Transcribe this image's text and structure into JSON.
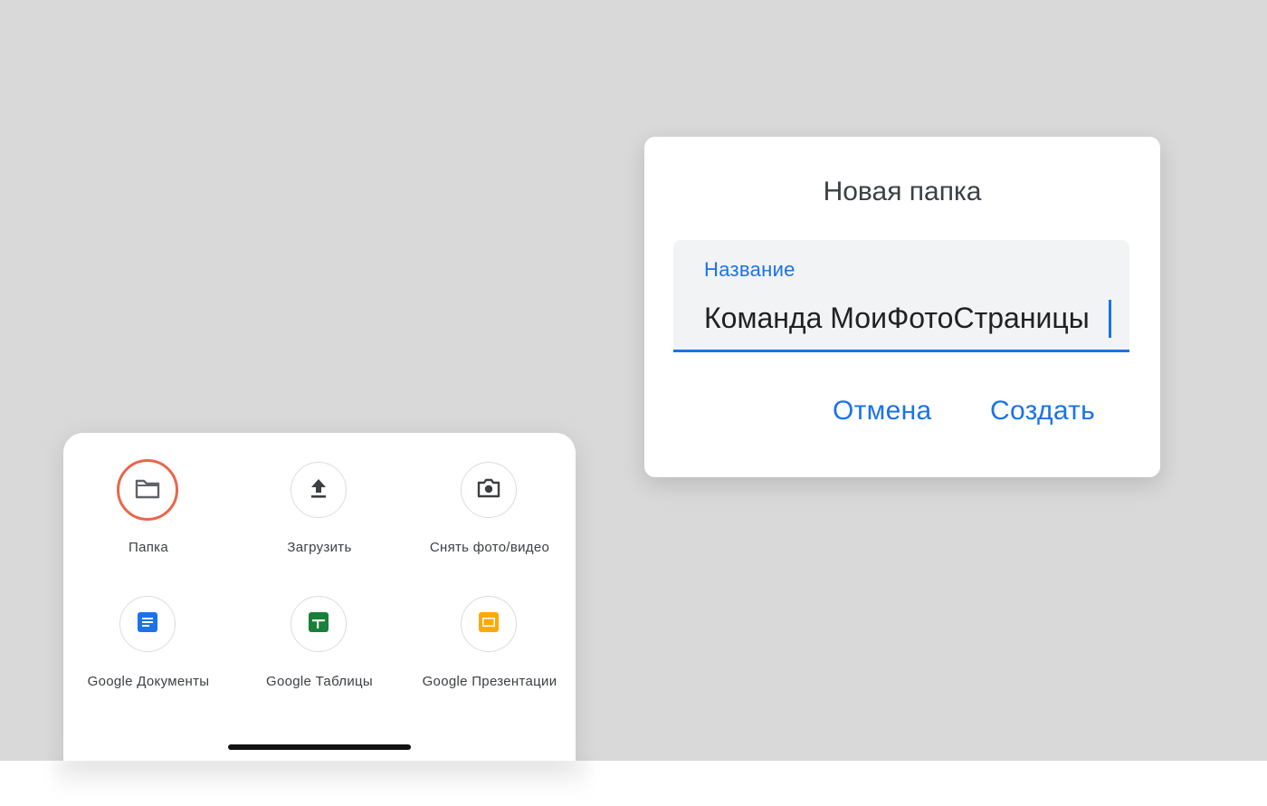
{
  "new_sheet": {
    "items": [
      {
        "label": "Папка",
        "icon": "folder-icon"
      },
      {
        "label": "Загрузить",
        "icon": "upload-icon"
      },
      {
        "label": "Снять фото/видео",
        "icon": "camera-icon"
      },
      {
        "label": "Google Документы",
        "icon": "google-docs-icon"
      },
      {
        "label": "Google Таблицы",
        "icon": "google-sheets-icon"
      },
      {
        "label": "Google Презентации",
        "icon": "google-slides-icon"
      }
    ]
  },
  "dialog": {
    "title": "Новая папка",
    "field_label": "Название",
    "field_value": "Команда МоиФотоСтраницы",
    "cancel_label": "Отмена",
    "create_label": "Создать"
  },
  "colors": {
    "accent": "#1a73e8",
    "highlight_ring": "#e8674b",
    "docs": "#1a73e8",
    "sheets": "#188038",
    "slides": "#f9ab00",
    "backdrop": "#d9d9d9"
  }
}
